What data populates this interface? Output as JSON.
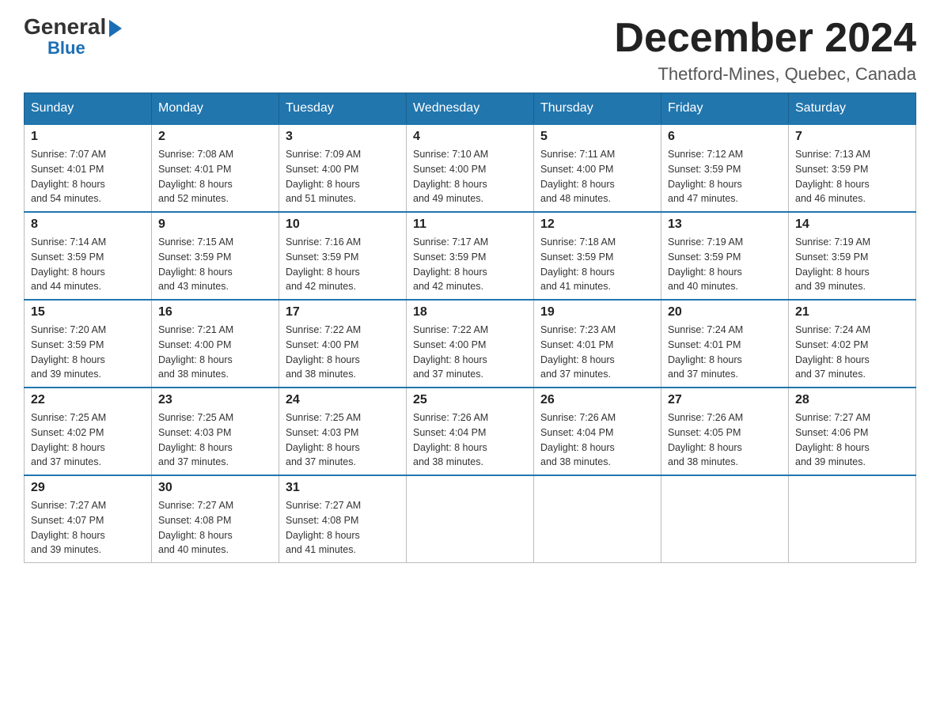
{
  "header": {
    "logo_general": "General",
    "logo_blue": "Blue",
    "month_title": "December 2024",
    "location": "Thetford-Mines, Quebec, Canada"
  },
  "days_of_week": [
    "Sunday",
    "Monday",
    "Tuesday",
    "Wednesday",
    "Thursday",
    "Friday",
    "Saturday"
  ],
  "weeks": [
    [
      {
        "day": "1",
        "sunrise": "7:07 AM",
        "sunset": "4:01 PM",
        "daylight": "8 hours and 54 minutes."
      },
      {
        "day": "2",
        "sunrise": "7:08 AM",
        "sunset": "4:01 PM",
        "daylight": "8 hours and 52 minutes."
      },
      {
        "day": "3",
        "sunrise": "7:09 AM",
        "sunset": "4:00 PM",
        "daylight": "8 hours and 51 minutes."
      },
      {
        "day": "4",
        "sunrise": "7:10 AM",
        "sunset": "4:00 PM",
        "daylight": "8 hours and 49 minutes."
      },
      {
        "day": "5",
        "sunrise": "7:11 AM",
        "sunset": "4:00 PM",
        "daylight": "8 hours and 48 minutes."
      },
      {
        "day": "6",
        "sunrise": "7:12 AM",
        "sunset": "3:59 PM",
        "daylight": "8 hours and 47 minutes."
      },
      {
        "day": "7",
        "sunrise": "7:13 AM",
        "sunset": "3:59 PM",
        "daylight": "8 hours and 46 minutes."
      }
    ],
    [
      {
        "day": "8",
        "sunrise": "7:14 AM",
        "sunset": "3:59 PM",
        "daylight": "8 hours and 44 minutes."
      },
      {
        "day": "9",
        "sunrise": "7:15 AM",
        "sunset": "3:59 PM",
        "daylight": "8 hours and 43 minutes."
      },
      {
        "day": "10",
        "sunrise": "7:16 AM",
        "sunset": "3:59 PM",
        "daylight": "8 hours and 42 minutes."
      },
      {
        "day": "11",
        "sunrise": "7:17 AM",
        "sunset": "3:59 PM",
        "daylight": "8 hours and 42 minutes."
      },
      {
        "day": "12",
        "sunrise": "7:18 AM",
        "sunset": "3:59 PM",
        "daylight": "8 hours and 41 minutes."
      },
      {
        "day": "13",
        "sunrise": "7:19 AM",
        "sunset": "3:59 PM",
        "daylight": "8 hours and 40 minutes."
      },
      {
        "day": "14",
        "sunrise": "7:19 AM",
        "sunset": "3:59 PM",
        "daylight": "8 hours and 39 minutes."
      }
    ],
    [
      {
        "day": "15",
        "sunrise": "7:20 AM",
        "sunset": "3:59 PM",
        "daylight": "8 hours and 39 minutes."
      },
      {
        "day": "16",
        "sunrise": "7:21 AM",
        "sunset": "4:00 PM",
        "daylight": "8 hours and 38 minutes."
      },
      {
        "day": "17",
        "sunrise": "7:22 AM",
        "sunset": "4:00 PM",
        "daylight": "8 hours and 38 minutes."
      },
      {
        "day": "18",
        "sunrise": "7:22 AM",
        "sunset": "4:00 PM",
        "daylight": "8 hours and 37 minutes."
      },
      {
        "day": "19",
        "sunrise": "7:23 AM",
        "sunset": "4:01 PM",
        "daylight": "8 hours and 37 minutes."
      },
      {
        "day": "20",
        "sunrise": "7:24 AM",
        "sunset": "4:01 PM",
        "daylight": "8 hours and 37 minutes."
      },
      {
        "day": "21",
        "sunrise": "7:24 AM",
        "sunset": "4:02 PM",
        "daylight": "8 hours and 37 minutes."
      }
    ],
    [
      {
        "day": "22",
        "sunrise": "7:25 AM",
        "sunset": "4:02 PM",
        "daylight": "8 hours and 37 minutes."
      },
      {
        "day": "23",
        "sunrise": "7:25 AM",
        "sunset": "4:03 PM",
        "daylight": "8 hours and 37 minutes."
      },
      {
        "day": "24",
        "sunrise": "7:25 AM",
        "sunset": "4:03 PM",
        "daylight": "8 hours and 37 minutes."
      },
      {
        "day": "25",
        "sunrise": "7:26 AM",
        "sunset": "4:04 PM",
        "daylight": "8 hours and 38 minutes."
      },
      {
        "day": "26",
        "sunrise": "7:26 AM",
        "sunset": "4:04 PM",
        "daylight": "8 hours and 38 minutes."
      },
      {
        "day": "27",
        "sunrise": "7:26 AM",
        "sunset": "4:05 PM",
        "daylight": "8 hours and 38 minutes."
      },
      {
        "day": "28",
        "sunrise": "7:27 AM",
        "sunset": "4:06 PM",
        "daylight": "8 hours and 39 minutes."
      }
    ],
    [
      {
        "day": "29",
        "sunrise": "7:27 AM",
        "sunset": "4:07 PM",
        "daylight": "8 hours and 39 minutes."
      },
      {
        "day": "30",
        "sunrise": "7:27 AM",
        "sunset": "4:08 PM",
        "daylight": "8 hours and 40 minutes."
      },
      {
        "day": "31",
        "sunrise": "7:27 AM",
        "sunset": "4:08 PM",
        "daylight": "8 hours and 41 minutes."
      },
      null,
      null,
      null,
      null
    ]
  ],
  "labels": {
    "sunrise": "Sunrise:",
    "sunset": "Sunset:",
    "daylight": "Daylight:"
  }
}
